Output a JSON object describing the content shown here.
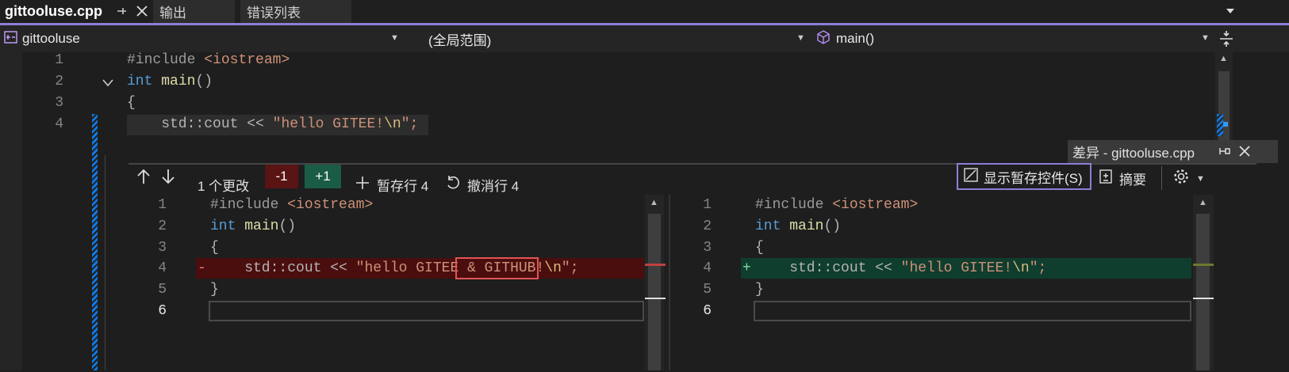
{
  "tabs": [
    {
      "label": "gittooluse.cpp",
      "active": true
    },
    {
      "label": "输出",
      "active": false
    },
    {
      "label": "错误列表",
      "active": false
    }
  ],
  "nav": {
    "project": "gittooluse",
    "scope": "(全局范围)",
    "member": "main()"
  },
  "editor": {
    "lines": [
      {
        "num": "1"
      },
      {
        "num": "2"
      },
      {
        "num": "3"
      },
      {
        "num": "4"
      }
    ],
    "code": {
      "l1_directive": "#include",
      "l1_header": "<iostream>",
      "l2_kw": "int",
      "l2_fn": "main",
      "l2_paren": "()",
      "l3": "{",
      "l4_pre": "    std::cout << ",
      "l4_str": "\"hello GITEE!",
      "l4_esc": "\\n",
      "l4_end": "\";"
    }
  },
  "diff": {
    "title": "差异 - gittooluse.cpp",
    "changes_label": "1 个更改",
    "minus_badge": "-1",
    "plus_badge": "+1",
    "stage_label": "暂存行 4",
    "revert_label": "撤消行 4",
    "show_staging_label": "显示暂存控件(S)",
    "summary_label": "摘要",
    "left": {
      "line_numbers": [
        "1",
        "2",
        "3",
        "4",
        "5",
        "6"
      ],
      "marker": "-",
      "l4_pre": "    std::cout << ",
      "l4_str_a": "\"hello GITEE",
      "l4_changed": " & GITHUB",
      "l4_str_b": "!",
      "l4_esc": "\\n",
      "l4_end": "\";",
      "l5": "}"
    },
    "right": {
      "line_numbers": [
        "1",
        "2",
        "3",
        "4",
        "5",
        "6"
      ],
      "marker": "+",
      "l4_pre": "    std::cout << ",
      "l4_str": "\"hello GITEE!",
      "l4_esc": "\\n",
      "l4_end": "\";",
      "l5": "}"
    }
  },
  "colors": {
    "accent": "#8b7fd6",
    "removed_bg": "#4b0e0e",
    "added_bg": "#0f3d2e",
    "change_marker": "#1177dd"
  },
  "icons": [
    "pin-icon",
    "close-icon",
    "project-icon",
    "cube-icon",
    "split-icon",
    "arrow-up-icon",
    "arrow-down-icon",
    "plus-icon",
    "undo-icon",
    "staging-icon",
    "summary-icon",
    "gear-icon",
    "chevron-down-icon"
  ]
}
